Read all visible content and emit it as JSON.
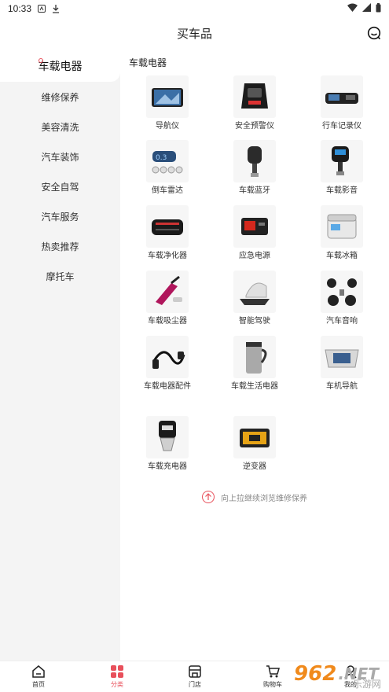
{
  "status_bar": {
    "time": "10:33"
  },
  "header": {
    "title": "买车品"
  },
  "sidebar": {
    "items": [
      {
        "label": "车载电器"
      },
      {
        "label": "维修保养"
      },
      {
        "label": "美容清洗"
      },
      {
        "label": "汽车装饰"
      },
      {
        "label": "安全自驾"
      },
      {
        "label": "汽车服务"
      },
      {
        "label": "热卖推荐"
      },
      {
        "label": "摩托车"
      }
    ]
  },
  "main": {
    "section_title": "车载电器",
    "items": [
      {
        "label": "导航仪",
        "icon": "gps-navigator-icon"
      },
      {
        "label": "安全预警仪",
        "icon": "radar-detector-icon"
      },
      {
        "label": "行车记录仪",
        "icon": "dashcam-mirror-icon"
      },
      {
        "label": "倒车雷达",
        "icon": "parking-sensor-icon"
      },
      {
        "label": "车载蓝牙",
        "icon": "bluetooth-fm-icon"
      },
      {
        "label": "车载影音",
        "icon": "car-mp3-icon"
      },
      {
        "label": "车载净化器",
        "icon": "air-purifier-icon"
      },
      {
        "label": "应急电源",
        "icon": "jump-starter-icon"
      },
      {
        "label": "车载冰箱",
        "icon": "car-fridge-icon"
      },
      {
        "label": "车载吸尘器",
        "icon": "car-vacuum-icon"
      },
      {
        "label": "智能驾驶",
        "icon": "hud-display-icon"
      },
      {
        "label": "汽车音响",
        "icon": "car-speaker-icon"
      },
      {
        "label": "车载电器配件",
        "icon": "power-cable-icon"
      },
      {
        "label": "车载生活电器",
        "icon": "electric-mug-icon"
      },
      {
        "label": "车机导航",
        "icon": "car-head-unit-icon"
      },
      {
        "label": "车载充电器",
        "icon": "car-charger-icon"
      },
      {
        "label": "逆变器",
        "icon": "power-inverter-icon"
      }
    ],
    "pull_hint": "向上拉继续浏览维修保养"
  },
  "bottom_nav": {
    "items": [
      {
        "label": "首页"
      },
      {
        "label": "分类"
      },
      {
        "label": "门店"
      },
      {
        "label": "购物车"
      },
      {
        "label": "我的"
      }
    ]
  },
  "watermark": {
    "number": "962",
    "suffix": ".NET",
    "sub": "乐游网"
  },
  "colors": {
    "accent": "#e8505b",
    "sidebar_bg": "#f4f4f4"
  }
}
